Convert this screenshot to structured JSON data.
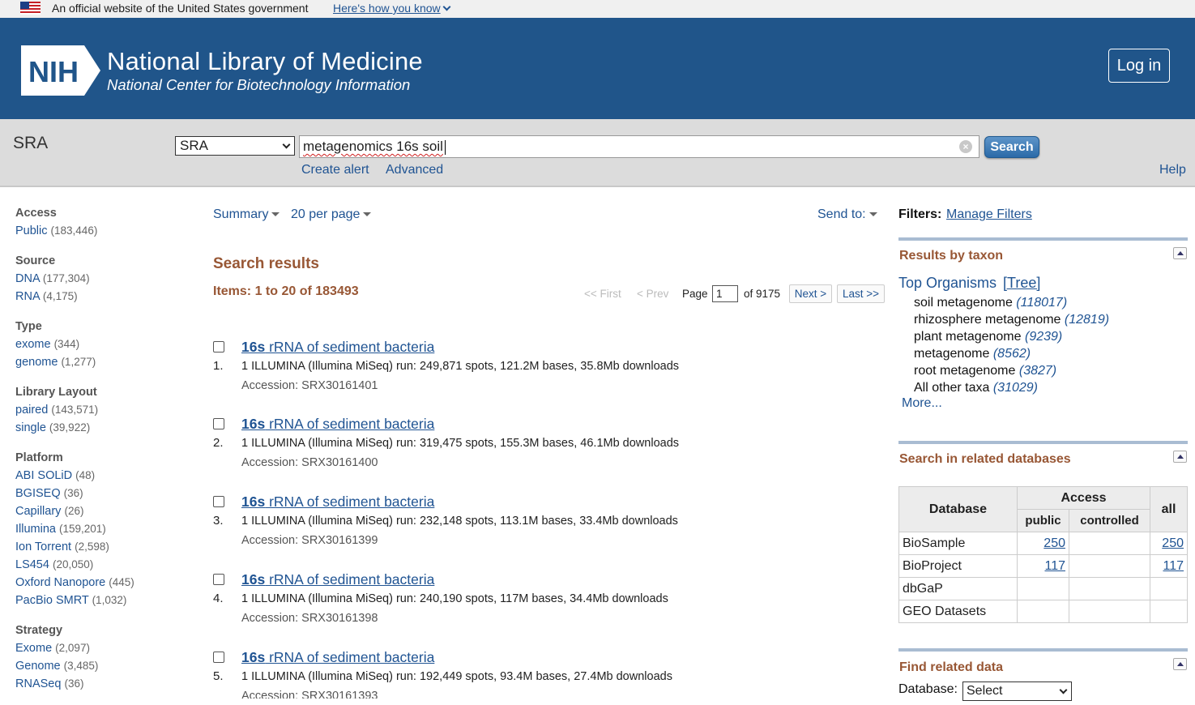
{
  "gov_banner": {
    "text": "An official website of the United States government",
    "link": "Here's how you know"
  },
  "header": {
    "logo_text": "NIH",
    "title": "National Library of Medicine",
    "subtitle": "National Center for Biotechnology Information",
    "login_label": "Log in"
  },
  "search": {
    "db_label": "SRA",
    "db_selected": "SRA",
    "query": "metagenomics 16s soil",
    "button": "Search",
    "create_alert": "Create alert",
    "advanced": "Advanced",
    "help": "Help"
  },
  "filters": [
    {
      "title": "Access",
      "items": [
        {
          "label": "Public",
          "count": "(183,446)"
        }
      ]
    },
    {
      "title": "Source",
      "items": [
        {
          "label": "DNA",
          "count": "(177,304)"
        },
        {
          "label": "RNA",
          "count": "(4,175)"
        }
      ]
    },
    {
      "title": "Type",
      "items": [
        {
          "label": "exome",
          "count": "(344)"
        },
        {
          "label": "genome",
          "count": "(1,277)"
        }
      ]
    },
    {
      "title": "Library Layout",
      "items": [
        {
          "label": "paired",
          "count": "(143,571)"
        },
        {
          "label": "single",
          "count": "(39,922)"
        }
      ]
    },
    {
      "title": "Platform",
      "items": [
        {
          "label": "ABI SOLiD",
          "count": "(48)"
        },
        {
          "label": "BGISEQ",
          "count": "(36)"
        },
        {
          "label": "Capillary",
          "count": "(26)"
        },
        {
          "label": "Illumina",
          "count": "(159,201)"
        },
        {
          "label": "Ion Torrent",
          "count": "(2,598)"
        },
        {
          "label": "LS454",
          "count": "(20,050)"
        },
        {
          "label": "Oxford Nanopore",
          "count": "(445)"
        },
        {
          "label": "PacBio SMRT",
          "count": "(1,032)"
        }
      ]
    },
    {
      "title": "Strategy",
      "items": [
        {
          "label": "Exome",
          "count": "(2,097)"
        },
        {
          "label": "Genome",
          "count": "(3,485)"
        },
        {
          "label": "RNASeq",
          "count": "(36)"
        }
      ]
    }
  ],
  "toolbar": {
    "format": "Summary",
    "per_page": "20 per page",
    "send_to": "Send to:"
  },
  "results": {
    "title": "Search results",
    "items_count": "Items: 1 to 20 of 183493",
    "pager": {
      "first": "<< First",
      "prev": "< Prev",
      "page_label": "Page",
      "page": "1",
      "of": "of 9175",
      "next": "Next >",
      "last": "Last >>"
    },
    "list": [
      {
        "num": "1.",
        "title_bold": "16s",
        "title_rest": " rRNA of sediment bacteria",
        "desc": "1 ILLUMINA (Illumina MiSeq) run: 249,871 spots, 121.2M bases, 35.8Mb downloads",
        "accession": "Accession: SRX30161401"
      },
      {
        "num": "2.",
        "title_bold": "16s",
        "title_rest": " rRNA of sediment bacteria",
        "desc": "1 ILLUMINA (Illumina MiSeq) run: 319,475 spots, 155.3M bases, 46.1Mb downloads",
        "accession": "Accession: SRX30161400"
      },
      {
        "num": "3.",
        "title_bold": "16s",
        "title_rest": " rRNA of sediment bacteria",
        "desc": "1 ILLUMINA (Illumina MiSeq) run: 232,148 spots, 113.1M bases, 33.4Mb downloads",
        "accession": "Accession: SRX30161399"
      },
      {
        "num": "4.",
        "title_bold": "16s",
        "title_rest": " rRNA of sediment bacteria",
        "desc": "1 ILLUMINA (Illumina MiSeq) run: 240,190 spots, 117M bases, 34.4Mb downloads",
        "accession": "Accession: SRX30161398"
      },
      {
        "num": "5.",
        "title_bold": "16s",
        "title_rest": " rRNA of sediment bacteria",
        "desc": "1 ILLUMINA (Illumina MiSeq) run: 192,449 spots, 93.4M bases, 27.4Mb downloads",
        "accession": "Accession: SRX30161393"
      }
    ]
  },
  "right": {
    "filters_label": "Filters:",
    "manage_filters": "Manage Filters",
    "taxon_title": "Results by taxon",
    "top_organisms": "Top Organisms",
    "tree": "[Tree]",
    "taxa": [
      {
        "name": "soil metagenome",
        "count": "(118017)"
      },
      {
        "name": "rhizosphere metagenome",
        "count": "(12819)"
      },
      {
        "name": "plant metagenome",
        "count": "(9239)"
      },
      {
        "name": "metagenome",
        "count": "(8562)"
      },
      {
        "name": "root metagenome",
        "count": "(3827)"
      },
      {
        "name": "All other taxa",
        "count": "(31029)"
      }
    ],
    "more": "More...",
    "related_title": "Search in related databases",
    "related_headers": {
      "database": "Database",
      "access": "Access",
      "public": "public",
      "controlled": "controlled",
      "all": "all"
    },
    "related_rows": [
      {
        "db": "BioSample",
        "public": "250",
        "controlled": "",
        "all": "250"
      },
      {
        "db": "BioProject",
        "public": "117",
        "controlled": "",
        "all": "117"
      },
      {
        "db": "dbGaP",
        "public": "",
        "controlled": "",
        "all": ""
      },
      {
        "db": "GEO Datasets",
        "public": "",
        "controlled": "",
        "all": ""
      }
    ],
    "find_title": "Find related data",
    "find_db_label": "Database:",
    "find_db_select": "Select"
  }
}
